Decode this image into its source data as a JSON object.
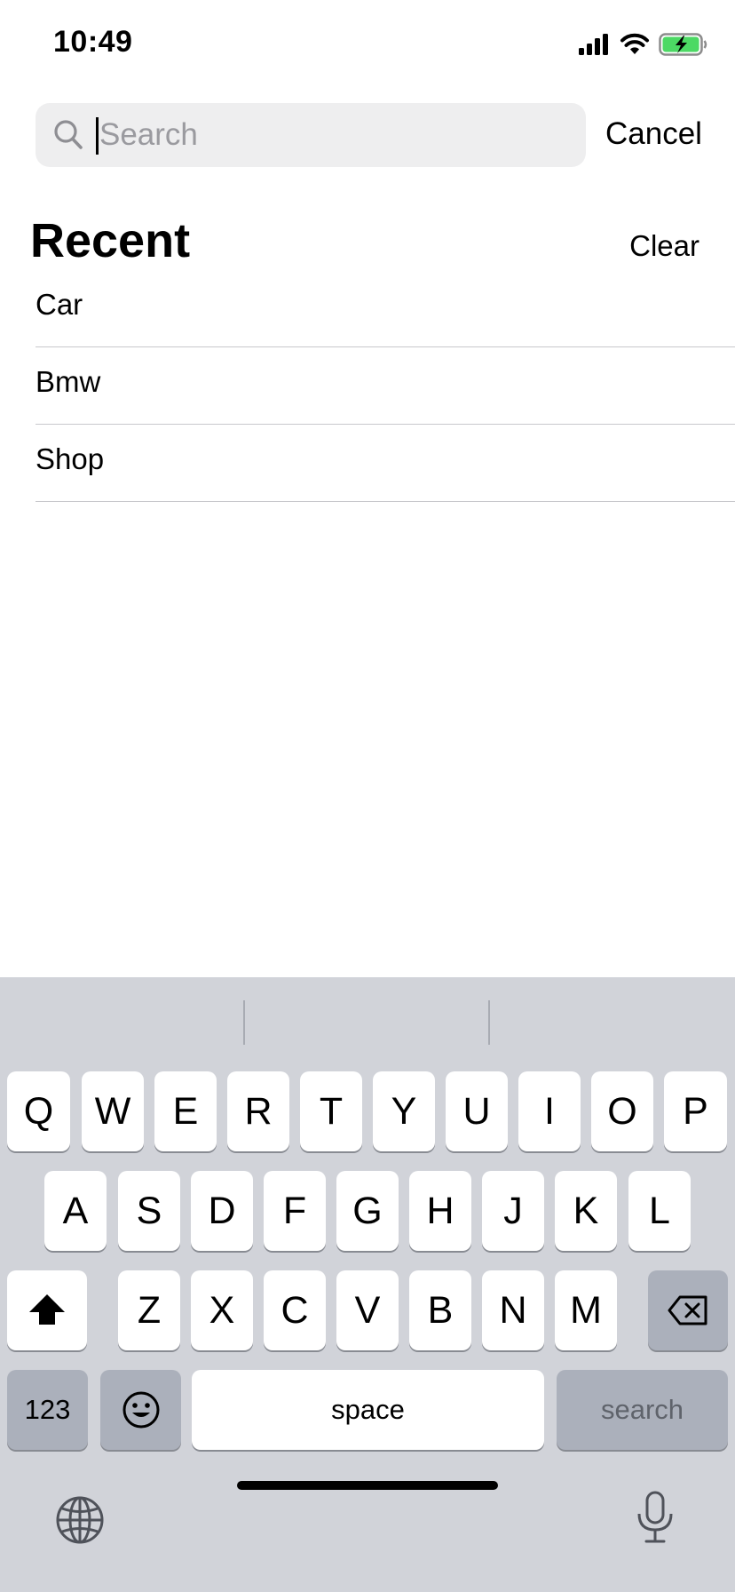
{
  "status_bar": {
    "time": "10:49",
    "signal_icon": "cellular-signal-icon",
    "wifi_icon": "wifi-icon",
    "battery_icon": "battery-charging-icon",
    "battery_color": "#4cd964"
  },
  "search": {
    "placeholder": "Search",
    "value": "",
    "icon": "search-icon",
    "cancel_label": "Cancel"
  },
  "recent": {
    "title": "Recent",
    "clear_label": "Clear",
    "items": [
      {
        "label": "Car"
      },
      {
        "label": "Bmw"
      },
      {
        "label": "Shop"
      }
    ]
  },
  "keyboard": {
    "row1": [
      "Q",
      "W",
      "E",
      "R",
      "T",
      "Y",
      "U",
      "I",
      "O",
      "P"
    ],
    "row2": [
      "A",
      "S",
      "D",
      "F",
      "G",
      "H",
      "J",
      "K",
      "L"
    ],
    "row3": [
      "Z",
      "X",
      "C",
      "V",
      "B",
      "N",
      "M"
    ],
    "shift_icon": "shift-icon",
    "delete_icon": "delete-icon",
    "numbers_label": "123",
    "emoji_icon": "emoji-icon",
    "space_label": "space",
    "search_label": "search",
    "globe_icon": "globe-icon",
    "mic_icon": "microphone-icon"
  }
}
